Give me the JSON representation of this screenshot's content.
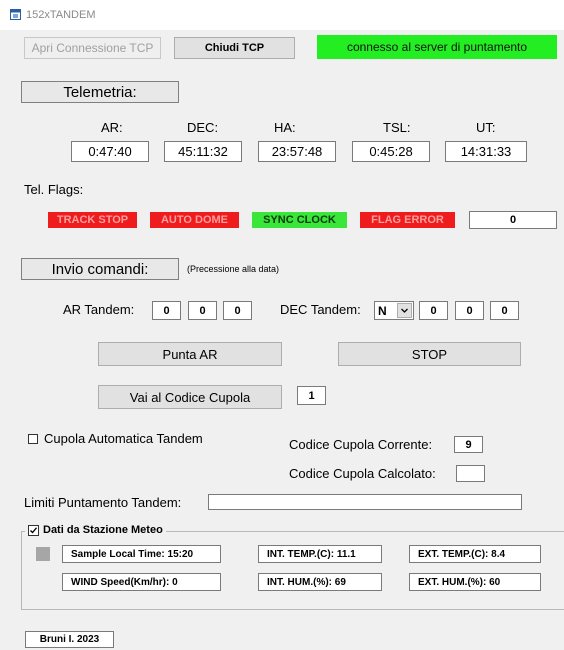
{
  "window": {
    "title": "152xTANDEM"
  },
  "tcp": {
    "open_label": "Apri Connessione TCP",
    "close_label": "Chiudi TCP",
    "status": "connesso al server di puntamento"
  },
  "telemetry": {
    "section_label": "Telemetria:",
    "columns": [
      {
        "label": "AR:",
        "value": "0:47:40"
      },
      {
        "label": "DEC:",
        "value": "45:11:32"
      },
      {
        "label": "HA:",
        "value": "23:57:48"
      },
      {
        "label": "TSL:",
        "value": "0:45:28"
      },
      {
        "label": "UT:",
        "value": "14:31:33"
      }
    ],
    "flags_label": "Tel. Flags:",
    "flags": [
      {
        "label": "TRACK STOP",
        "color": "#ee1c1c"
      },
      {
        "label": "AUTO DOME",
        "color": "#ee1c1c"
      },
      {
        "label": "SYNC CLOCK",
        "color": "#39e639"
      },
      {
        "label": "FLAG ERROR",
        "color": "#ee1c1c"
      }
    ],
    "flag_value": "0"
  },
  "commands": {
    "section_label": "Invio comandi:",
    "note": "(Precessione alla data)",
    "ar_label": "AR Tandem:",
    "ar_values": [
      "0",
      "0",
      "0"
    ],
    "dec_label": "DEC Tandem:",
    "dec_sign": "N",
    "dec_values": [
      "0",
      "0",
      "0"
    ],
    "punta_label": "Punta AR",
    "stop_label": "STOP",
    "dome_button_label": "Vai al Codice Cupola",
    "dome_code": "1"
  },
  "dome": {
    "auto_label": "Cupola Automatica Tandem",
    "current_label": "Codice Cupola Corrente:",
    "current_value": "9",
    "computed_label": "Codice Cupola Calcolato:",
    "computed_value": "",
    "limits_label": "Limiti Puntamento Tandem:",
    "limits_value": ""
  },
  "meteo": {
    "group_label": "Dati da Stazione Meteo",
    "sample_time": "Sample Local Time: 15:20",
    "int_temp": "INT. TEMP.(C):  11.1",
    "ext_temp": "EXT. TEMP.(C):   8.4",
    "wind": "WIND Speed(Km/hr):  0",
    "int_hum": "INT. HUM.(%):  69",
    "ext_hum": "EXT. HUM.(%):  60"
  },
  "footer": {
    "credit": "Bruni I. 2023"
  }
}
